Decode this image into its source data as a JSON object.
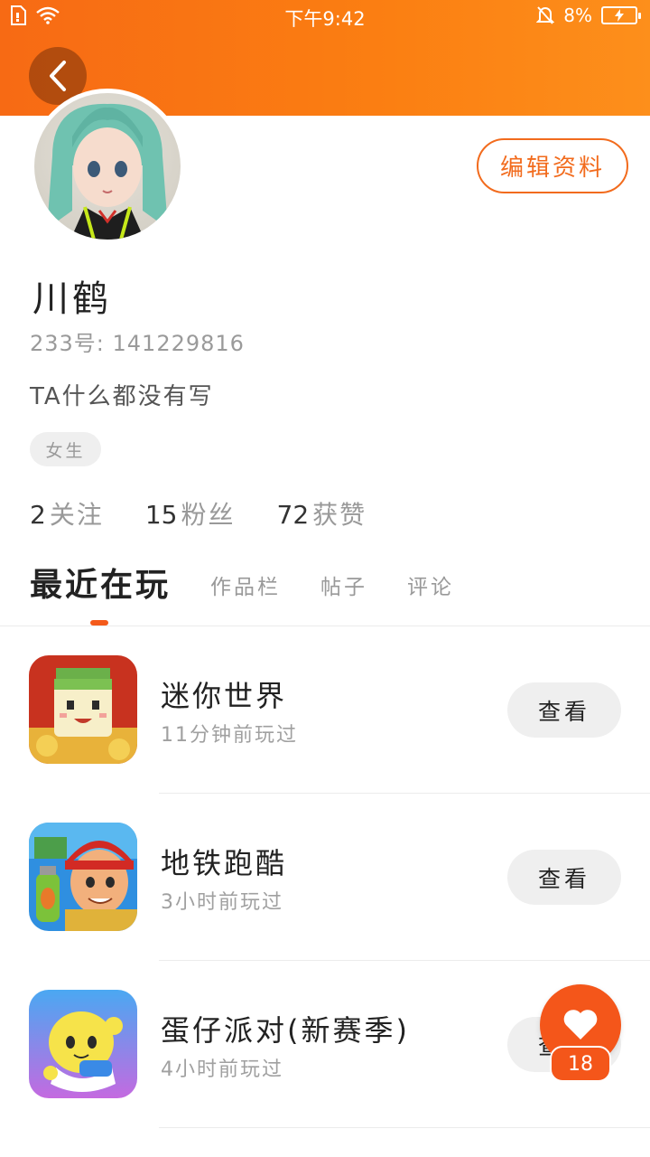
{
  "status_bar": {
    "time": "下午9:42",
    "battery_percent": "8%"
  },
  "profile": {
    "edit_label": "编辑资料",
    "username": "川鹤",
    "id_text": "233号: 141229816",
    "bio": "TA什么都没有写",
    "gender": "女生"
  },
  "stats": [
    {
      "num": "2",
      "label": "关注"
    },
    {
      "num": "15",
      "label": "粉丝"
    },
    {
      "num": "72",
      "label": "获赞"
    }
  ],
  "tabs": [
    {
      "label": "最近在玩",
      "active": true
    },
    {
      "label": "作品栏",
      "active": false
    },
    {
      "label": "帖子",
      "active": false
    },
    {
      "label": "评论",
      "active": false
    }
  ],
  "games": [
    {
      "name": "迷你世界",
      "time": "11分钟前玩过",
      "button": "查看",
      "icon": "mini-world-icon"
    },
    {
      "name": "地铁跑酷",
      "time": "3小时前玩过",
      "button": "查看",
      "icon": "subway-surfers-icon"
    },
    {
      "name": "蛋仔派对(新赛季)",
      "time": "4小时前玩过",
      "button": "查看",
      "icon": "eggy-party-icon"
    }
  ],
  "like": {
    "count": "18"
  },
  "colors": {
    "accent": "#f4561a",
    "header_start": "#f76a14",
    "header_end": "#fd8f1b"
  }
}
